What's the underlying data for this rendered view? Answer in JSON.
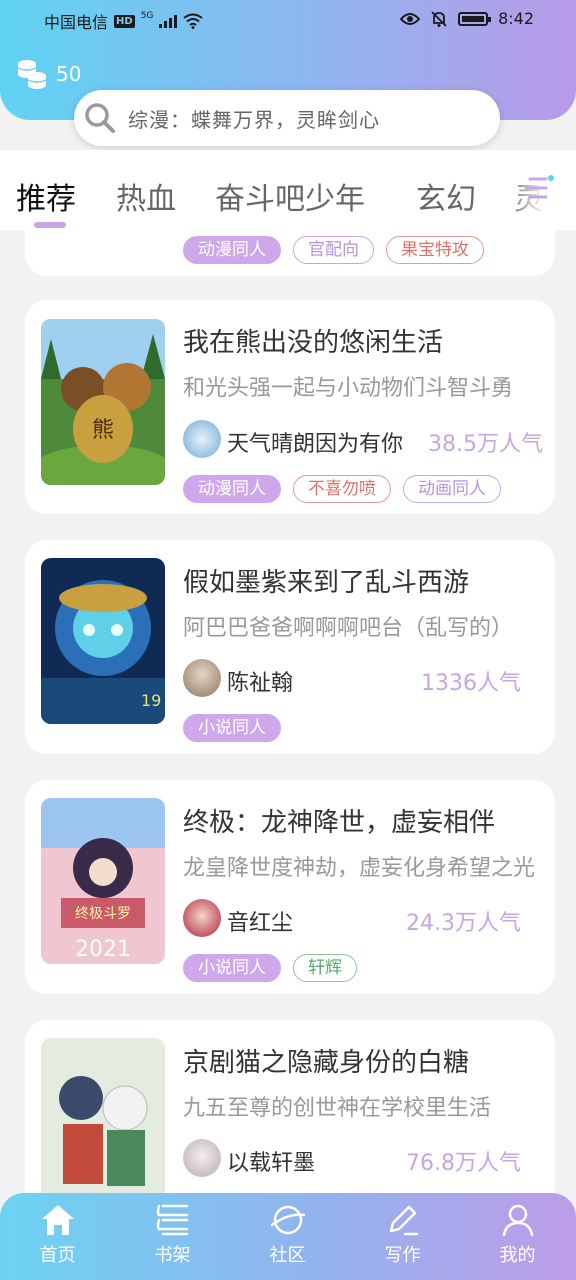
{
  "status_bar": {
    "carrier": "中国电信",
    "hd": "HD",
    "network": "5G",
    "time": "8:42"
  },
  "header": {
    "coin_count": "50",
    "search_placeholder": "综漫：蝶舞万界，灵眸剑心"
  },
  "tabs": [
    {
      "label": "推荐",
      "active": true
    },
    {
      "label": "热血"
    },
    {
      "label": "奋斗吧少年"
    },
    {
      "label": "玄幻"
    },
    {
      "label": "灵异"
    }
  ],
  "cards": [
    {
      "tags": [
        {
          "label": "动漫同人",
          "style": "filled"
        },
        {
          "label": "官配向",
          "style": "outline-purple"
        },
        {
          "label": "果宝特攻",
          "style": "outline-red"
        }
      ]
    },
    {
      "title": "我在熊出没的悠闲生活",
      "desc": "和光头强一起与小动物们斗智斗勇",
      "author": "天气晴朗因为有你",
      "popularity": "38.5万人气",
      "tags": [
        {
          "label": "动漫同人",
          "style": "filled"
        },
        {
          "label": "不喜勿喷",
          "style": "outline-red"
        },
        {
          "label": "动画同人",
          "style": "outline-purple"
        }
      ]
    },
    {
      "title": "假如墨紫来到了乱斗西游",
      "desc": "阿巴巴爸爸啊啊啊吧台（乱写的）",
      "author": "陈祉翰",
      "popularity": "1336人气",
      "tags": [
        {
          "label": "小说同人",
          "style": "filled"
        }
      ]
    },
    {
      "title": "终极：龙神降世，虚妄相伴",
      "desc": "龙皇降世度神劫，虚妄化身希望之光",
      "author": "音红尘",
      "popularity": "24.3万人气",
      "tags": [
        {
          "label": "小说同人",
          "style": "filled"
        },
        {
          "label": "轩辉",
          "style": "outline-green"
        }
      ]
    },
    {
      "title": "京剧猫之隐藏身份的白糖",
      "desc": "九五至尊的创世神在学校里生活",
      "author": "以载轩墨",
      "popularity": "76.8万人气"
    }
  ],
  "bottom_nav": [
    {
      "label": "首页",
      "icon": "home-icon"
    },
    {
      "label": "书架",
      "icon": "bookshelf-icon"
    },
    {
      "label": "社区",
      "icon": "planet-icon"
    },
    {
      "label": "写作",
      "icon": "pen-icon"
    },
    {
      "label": "我的",
      "icon": "user-icon"
    }
  ],
  "colors": {
    "accent_purple": "#c7a6e6",
    "header_start": "#5fd3f3",
    "header_end": "#b99ae8"
  }
}
